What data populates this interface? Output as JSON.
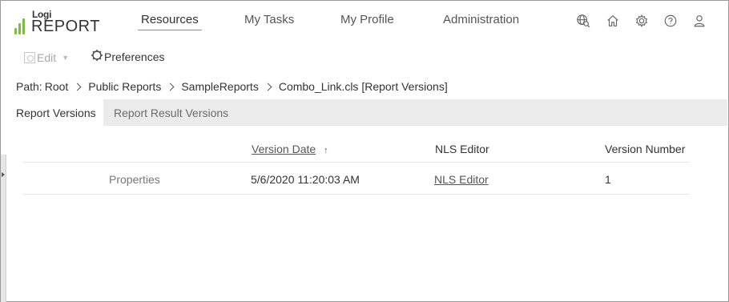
{
  "logo": {
    "small_text": "Logi",
    "big_text": "REPORT",
    "accent_color": "#7cbd3f"
  },
  "nav": {
    "items": [
      {
        "label": "Resources",
        "active": true
      },
      {
        "label": "My Tasks",
        "active": false
      },
      {
        "label": "My Profile",
        "active": false
      },
      {
        "label": "Administration",
        "active": false
      }
    ],
    "active_underline_color": "#e07a2e"
  },
  "header_icons": [
    "globe-search-icon",
    "home-icon",
    "gear-icon",
    "help-icon",
    "user-icon"
  ],
  "toolbar": {
    "edit_label": "Edit",
    "preferences_label": "Preferences"
  },
  "breadcrumb": {
    "prefix": "Path:",
    "items": [
      "Root",
      "Public Reports",
      "SampleReports",
      "Combo_Link.cls [Report Versions]"
    ]
  },
  "tabs": [
    {
      "label": "Report Versions",
      "active": true
    },
    {
      "label": "Report Result Versions",
      "active": false
    }
  ],
  "table": {
    "columns": [
      "Version Date",
      "NLS Editor",
      "Version Number"
    ],
    "sort_indicator": "↑",
    "rows": [
      {
        "properties": "Properties",
        "version_date": "5/6/2020 11:20:03 AM",
        "nls_editor": "NLS Editor",
        "version_number": "1"
      }
    ]
  }
}
